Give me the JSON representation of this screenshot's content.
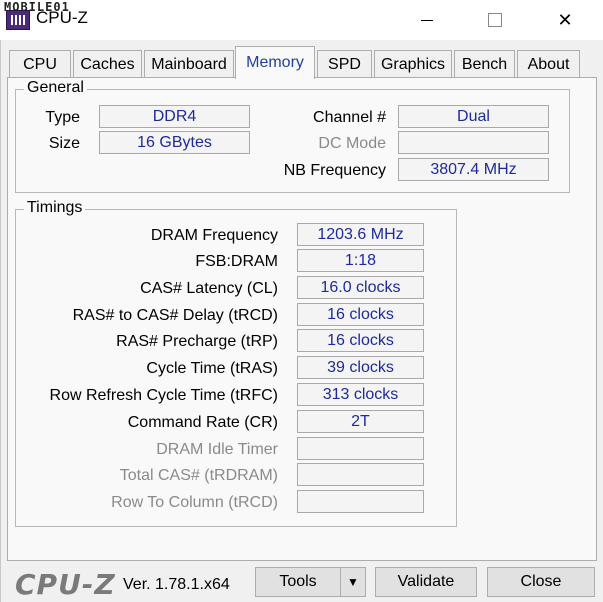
{
  "window": {
    "title": "CPU-Z",
    "watermark": "MOBILE01"
  },
  "tabs": [
    {
      "label": "CPU"
    },
    {
      "label": "Caches"
    },
    {
      "label": "Mainboard"
    },
    {
      "label": "Memory"
    },
    {
      "label": "SPD"
    },
    {
      "label": "Graphics"
    },
    {
      "label": "Bench"
    },
    {
      "label": "About"
    }
  ],
  "active_tab": "Memory",
  "general": {
    "title": "General",
    "type_label": "Type",
    "type_value": "DDR4",
    "size_label": "Size",
    "size_value": "16 GBytes",
    "channel_label": "Channel #",
    "channel_value": "Dual",
    "dcmode_label": "DC Mode",
    "dcmode_value": "",
    "nbfreq_label": "NB Frequency",
    "nbfreq_value": "3807.4 MHz"
  },
  "timings": {
    "title": "Timings",
    "rows": [
      {
        "label": "DRAM Frequency",
        "value": "1203.6 MHz",
        "enabled": true
      },
      {
        "label": "FSB:DRAM",
        "value": "1:18",
        "enabled": true
      },
      {
        "label": "CAS# Latency (CL)",
        "value": "16.0 clocks",
        "enabled": true
      },
      {
        "label": "RAS# to CAS# Delay (tRCD)",
        "value": "16 clocks",
        "enabled": true
      },
      {
        "label": "RAS# Precharge (tRP)",
        "value": "16 clocks",
        "enabled": true
      },
      {
        "label": "Cycle Time (tRAS)",
        "value": "39 clocks",
        "enabled": true
      },
      {
        "label": "Row Refresh Cycle Time (tRFC)",
        "value": "313 clocks",
        "enabled": true
      },
      {
        "label": "Command Rate (CR)",
        "value": "2T",
        "enabled": true
      },
      {
        "label": "DRAM Idle Timer",
        "value": "",
        "enabled": false
      },
      {
        "label": "Total CAS# (tRDRAM)",
        "value": "",
        "enabled": false
      },
      {
        "label": "Row To Column (tRCD)",
        "value": "",
        "enabled": false
      }
    ]
  },
  "footer": {
    "logo": "CPU-Z",
    "version": "Ver. 1.78.1.x64",
    "tools_label": "Tools",
    "validate_label": "Validate",
    "close_label": "Close"
  },
  "colors": {
    "value_text": "#1e2a9c",
    "active_tab_text": "#1e3fa0",
    "disabled_text": "#8a8a8a"
  }
}
